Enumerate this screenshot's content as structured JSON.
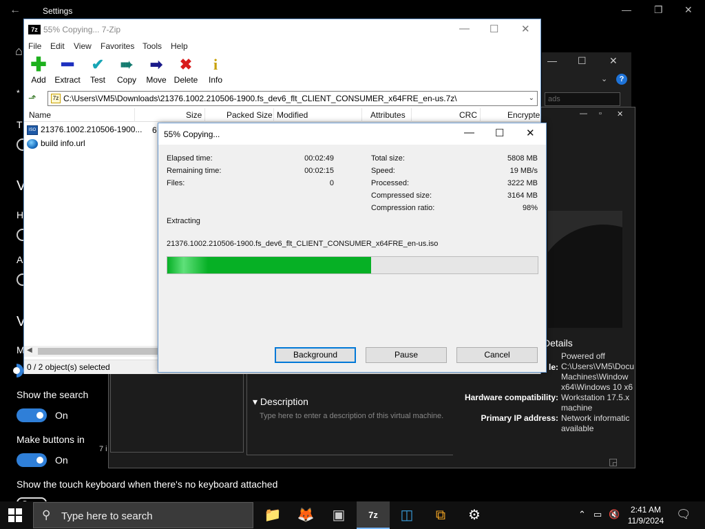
{
  "settings": {
    "title": "Settings",
    "fragments": [
      "T",
      "V",
      "H",
      "A",
      "V",
      "M"
    ],
    "options": [
      {
        "label": "Show the search",
        "state": "On",
        "on": true
      },
      {
        "label": "Make buttons in",
        "state": "On",
        "on": true
      },
      {
        "label": "Show the touch keyboard when there's no keyboard attached",
        "state": "",
        "on": false
      }
    ]
  },
  "vmware": {
    "search_placeholder": "ads",
    "details_heading": "Details",
    "details": [
      {
        "key": "",
        "value": "Powered off"
      },
      {
        "key": "le:",
        "value": "C:\\Users\\VM5\\Docu Machines\\Window x64\\Windows 10 x6"
      },
      {
        "key": "Hardware compatibility:",
        "value": "Workstation 17.5.x machine"
      },
      {
        "key": "Primary IP address:",
        "value": "Network informatic available"
      }
    ],
    "description_heading": "Description",
    "description_placeholder": "Type here to enter a description of this virtual machine.",
    "panel_fragment": "7 i"
  },
  "zip": {
    "title": "55% Copying... 7-Zip",
    "menu": [
      "File",
      "Edit",
      "View",
      "Favorites",
      "Tools",
      "Help"
    ],
    "toolbar": [
      {
        "label": "Add",
        "icon": "plus-icon",
        "color": "#1db01d"
      },
      {
        "label": "Extract",
        "icon": "minus-icon",
        "color": "#1c2fbf"
      },
      {
        "label": "Test",
        "icon": "check-icon",
        "color": "#17a5b5"
      },
      {
        "label": "Copy",
        "icon": "double-arrow-icon",
        "color": "#137a6f"
      },
      {
        "label": "Move",
        "icon": "arrow-right-icon",
        "color": "#1a1a8a"
      },
      {
        "label": "Delete",
        "icon": "x-icon",
        "color": "#d81b1b"
      },
      {
        "label": "Info",
        "icon": "info-icon",
        "color": "#c8a000"
      }
    ],
    "address": "C:\\Users\\VM5\\Downloads\\21376.1002.210506-1900.fs_dev6_flt_CLIENT_CONSUMER_x64FRE_en-us.7z\\",
    "columns": [
      "Name",
      "Size",
      "Packed Size",
      "Modified",
      "Attributes",
      "CRC",
      "Encrypte"
    ],
    "files": [
      {
        "name": "21376.1002.210506-1900...",
        "size": "6",
        "icon": "iso-icon"
      },
      {
        "name": "build info.url",
        "size": "",
        "icon": "url-icon"
      }
    ],
    "status": "0 / 2 object(s) selected"
  },
  "dialog": {
    "title": "55% Copying...",
    "left_stats": [
      {
        "label": "Elapsed time:",
        "value": "00:02:49"
      },
      {
        "label": "Remaining time:",
        "value": "00:02:15"
      },
      {
        "label": "Files:",
        "value": "0"
      }
    ],
    "right_stats": [
      {
        "label": "Total size:",
        "value": "5808 MB"
      },
      {
        "label": "Speed:",
        "value": "19 MB/s"
      },
      {
        "label": "Processed:",
        "value": "3222 MB"
      },
      {
        "label": "Compressed size:",
        "value": "3164 MB"
      },
      {
        "label": "Compression ratio:",
        "value": "98%"
      }
    ],
    "operation": "Extracting",
    "current_file": "21376.1002.210506-1900.fs_dev6_flt_CLIENT_CONSUMER_x64FRE_en-us.iso",
    "progress": 0.55,
    "buttons": {
      "background": "Background",
      "pause": "Pause",
      "cancel": "Cancel"
    }
  },
  "taskbar": {
    "search_placeholder": "Type here to search",
    "apps": [
      {
        "name": "file-explorer-icon",
        "glyph": "📁",
        "color": "#f2c14e",
        "active": false
      },
      {
        "name": "firefox-icon",
        "glyph": "🦊",
        "color": "#ff7139",
        "active": false
      },
      {
        "name": "vm-app-icon",
        "glyph": "▣",
        "color": "#cccccc",
        "active": false
      },
      {
        "name": "7zip-icon",
        "glyph": "7z",
        "color": "#ffffff",
        "active": true
      },
      {
        "name": "vmware-icon",
        "glyph": "◫",
        "color": "#3aa0e0",
        "active": false
      },
      {
        "name": "workstation-icon",
        "glyph": "⧉",
        "color": "#f5a623",
        "active": false
      },
      {
        "name": "settings-gear-icon",
        "glyph": "⚙",
        "color": "#ffffff",
        "active": false
      }
    ],
    "time": "2:41 AM",
    "date": "11/9/2024"
  },
  "colors": {
    "accent": "#0078d7",
    "progress": "#06b025",
    "toggle_on": "#2f7fd8"
  }
}
